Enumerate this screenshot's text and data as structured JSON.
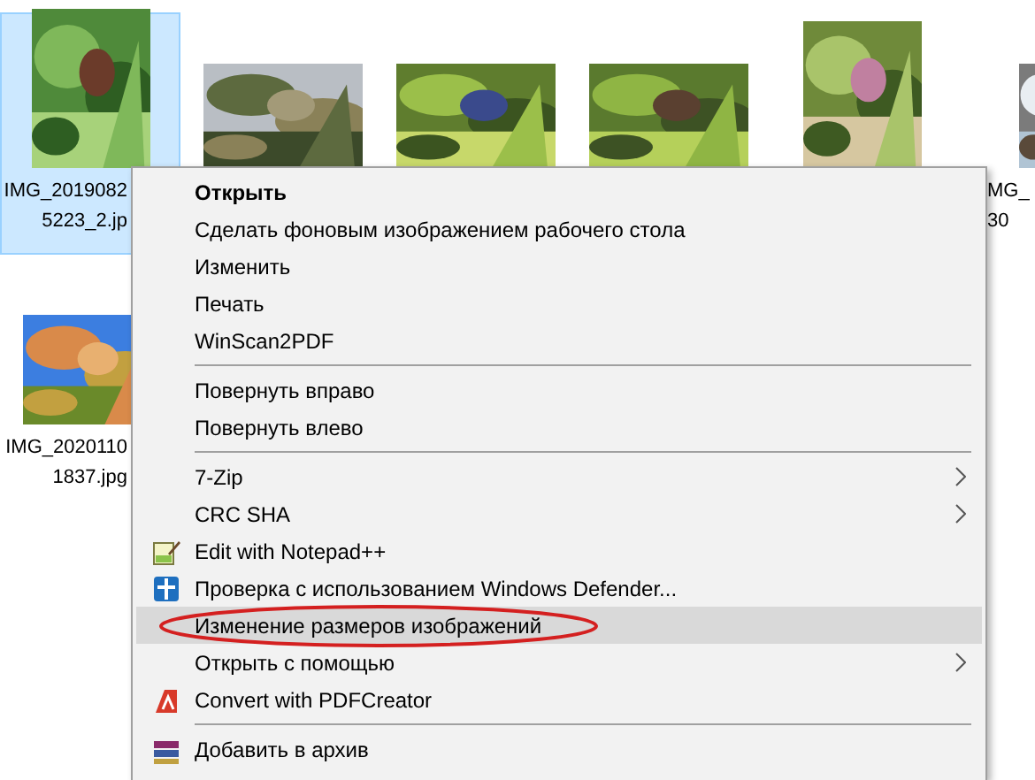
{
  "files": [
    {
      "kind": "picture",
      "lines": [
        "IMG_2019082",
        "5223_2.jp"
      ],
      "selected": true
    },
    {
      "kind": "picture",
      "selected": false
    },
    {
      "kind": "picture",
      "selected": false
    },
    {
      "kind": "picture",
      "selected": false
    },
    {
      "kind": "picture",
      "selected": false
    },
    {
      "kind": "picture",
      "lines": [
        "MG_",
        "30"
      ],
      "selected": false
    },
    {
      "kind": "picture",
      "lines": [
        "IMG_2020110",
        "1837.jpg"
      ],
      "selected": false
    }
  ],
  "context_menu": {
    "items": [
      {
        "kind": "item",
        "label": "Открыть",
        "default": true,
        "submenu": false,
        "selected": false,
        "annotated": false
      },
      {
        "kind": "item",
        "label": "Сделать фоновым изображением рабочего стола",
        "default": false,
        "submenu": false,
        "selected": false,
        "annotated": false
      },
      {
        "kind": "item",
        "label": "Изменить",
        "default": false,
        "submenu": false,
        "selected": false,
        "annotated": false
      },
      {
        "kind": "item",
        "label": "Печать",
        "default": false,
        "submenu": false,
        "selected": false,
        "annotated": false
      },
      {
        "kind": "item",
        "label": "WinScan2PDF",
        "default": false,
        "submenu": false,
        "selected": false,
        "annotated": false
      },
      {
        "kind": "separator"
      },
      {
        "kind": "item",
        "label": "Повернуть вправо",
        "default": false,
        "submenu": false,
        "selected": false,
        "annotated": false
      },
      {
        "kind": "item",
        "label": "Повернуть влево",
        "default": false,
        "submenu": false,
        "selected": false,
        "annotated": false
      },
      {
        "kind": "separator"
      },
      {
        "kind": "item",
        "label": "7-Zip",
        "default": false,
        "submenu": true,
        "selected": false,
        "annotated": false
      },
      {
        "kind": "item",
        "label": "CRC SHA",
        "default": false,
        "submenu": true,
        "selected": false,
        "annotated": false
      },
      {
        "kind": "item",
        "label": "Edit with Notepad++",
        "default": false,
        "submenu": false,
        "selected": false,
        "annotated": false
      },
      {
        "kind": "item",
        "label": "Проверка с использованием Windows Defender...",
        "default": false,
        "submenu": false,
        "selected": false,
        "annotated": false
      },
      {
        "kind": "item",
        "label": "Изменение размеров изображений",
        "default": false,
        "submenu": false,
        "selected": true,
        "annotated": true
      },
      {
        "kind": "item",
        "label": "Открыть с помощью",
        "default": false,
        "submenu": true,
        "selected": false,
        "annotated": false
      },
      {
        "kind": "item",
        "label": "Convert with PDFCreator",
        "default": false,
        "submenu": false,
        "selected": false,
        "annotated": false
      },
      {
        "kind": "separator"
      },
      {
        "kind": "item",
        "label": "Добавить в архив",
        "default": false,
        "submenu": false,
        "selected": false,
        "annotated": false
      }
    ]
  }
}
